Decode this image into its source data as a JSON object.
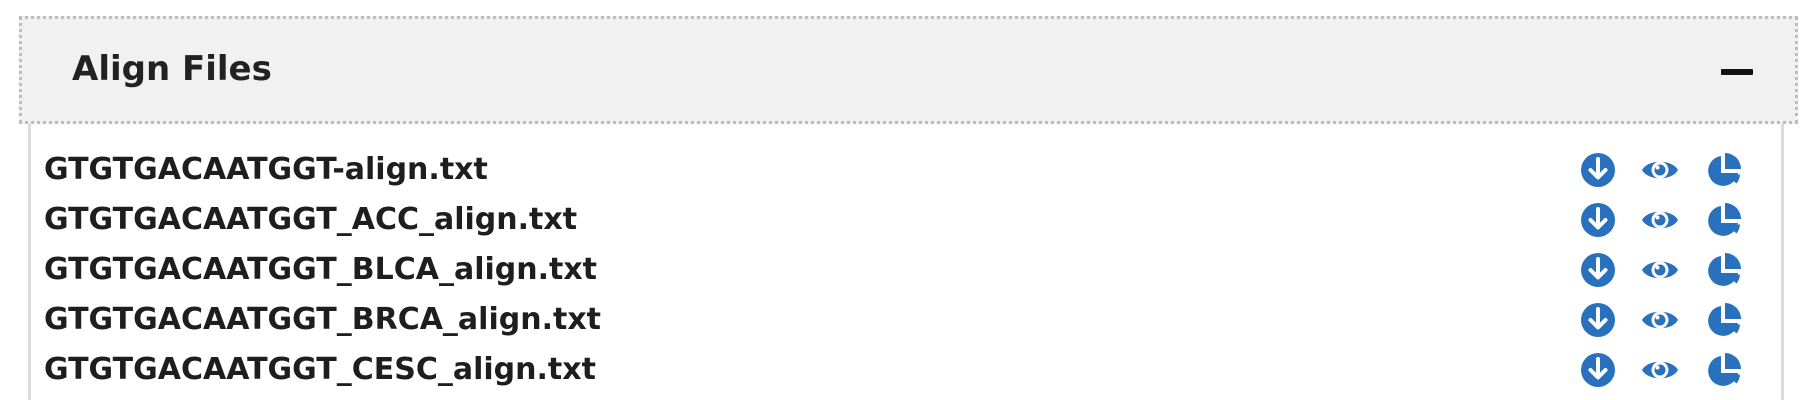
{
  "panel": {
    "title": "Align Files"
  },
  "files": [
    {
      "name": "GTGTGACAATGGT-align.txt"
    },
    {
      "name": "GTGTGACAATGGT_ACC_align.txt"
    },
    {
      "name": "GTGTGACAATGGT_BLCA_align.txt"
    },
    {
      "name": "GTGTGACAATGGT_BRCA_align.txt"
    },
    {
      "name": "GTGTGACAATGGT_CESC_align.txt"
    }
  ],
  "icons": {
    "collapse": "minus-icon",
    "download": "download-icon",
    "view": "eye-icon",
    "stats": "pie-chart-icon"
  },
  "colors": {
    "accent": "#2a71bd",
    "header_bg": "#f1f1f1"
  }
}
